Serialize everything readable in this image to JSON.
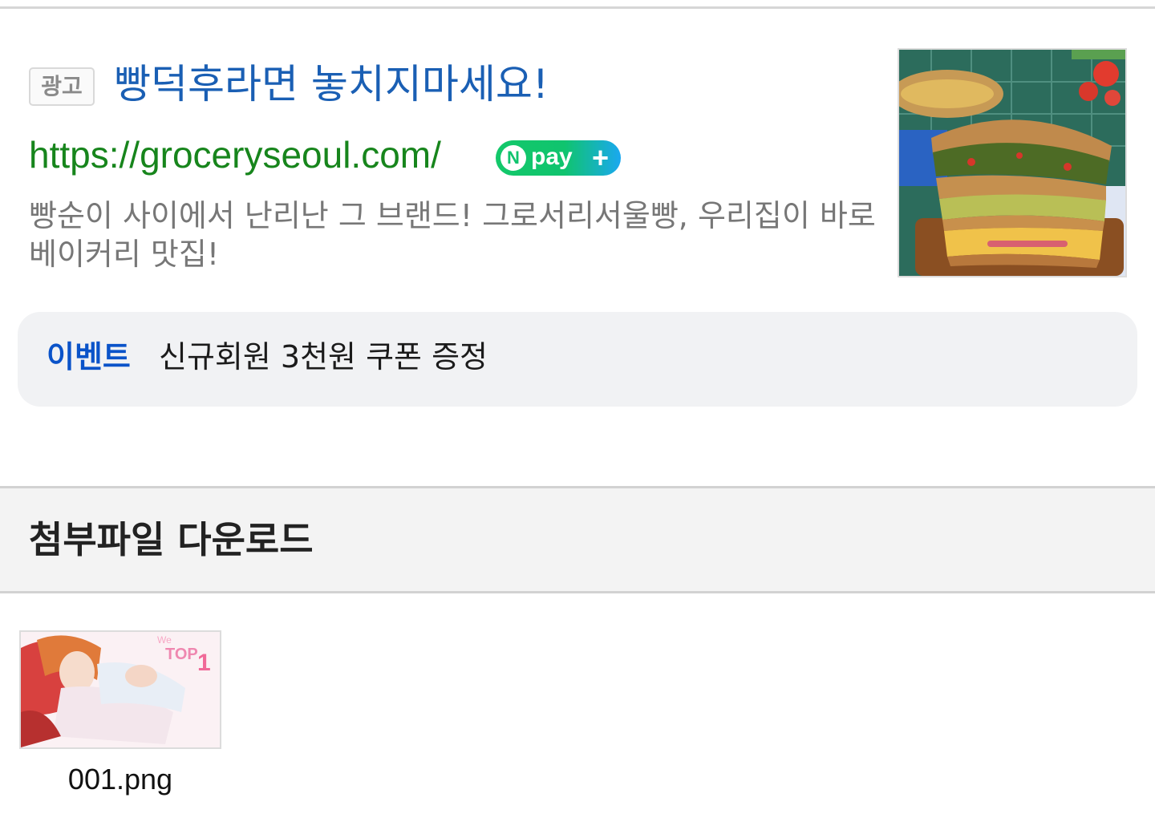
{
  "ad": {
    "badge": "광고",
    "title": "빵덕후라면 놓치지마세요!",
    "url": "https://groceryseoul.com/",
    "npay": {
      "n": "N",
      "text": "pay",
      "plus": "+"
    },
    "description": "빵순이 사이에서 난리난 그 브랜드! 그로서리서울빵, 우리집이 바로 베이커리 맛집!",
    "thumbnail_icon": "bread-sandwich-photo",
    "event": {
      "label": "이벤트",
      "text": "신규회원 3천원 쿠폰 증정"
    }
  },
  "attachments": {
    "title": "첨부파일 다운로드",
    "files": [
      {
        "name": "001.png",
        "thumbnail_icon": "anime-illustration-thumbnail"
      }
    ]
  },
  "colors": {
    "title_link": "#1a5fb4",
    "url_green": "#17851c",
    "event_blue": "#0a53c9",
    "npay_green": "#10c46e",
    "npay_blue": "#1aa8f0"
  }
}
